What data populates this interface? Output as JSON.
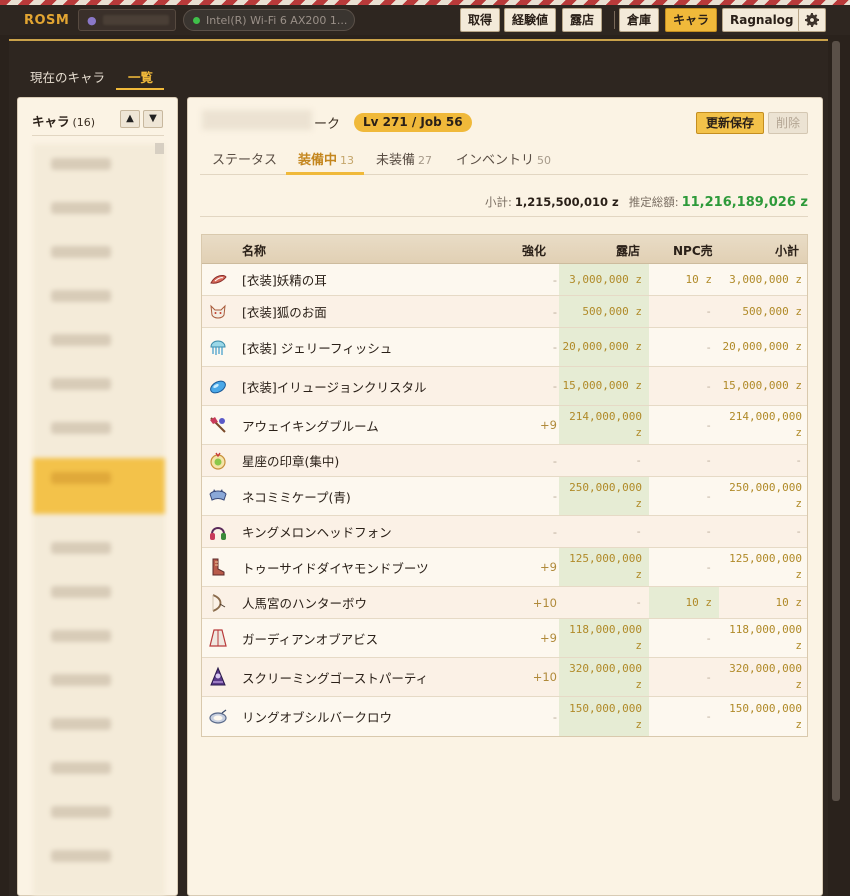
{
  "topbar": {
    "logo": "ROSM",
    "network": "Intel(R) Wi-Fi 6 AX200 1...",
    "buttons": [
      "取得",
      "経験値",
      "露店",
      "倉庫",
      "キャラ",
      "Ragnalog"
    ],
    "active_button": "キャラ"
  },
  "main_tabs": [
    "現在のキャラ",
    "一覧"
  ],
  "sidebar": {
    "title": "キャラ",
    "count": "(16)",
    "up": "▲",
    "down": "▼"
  },
  "character": {
    "name_suffix": "ーク",
    "level": "Lv 271 / Job 56",
    "save_label": "更新保存",
    "delete_label": "削除"
  },
  "tabs": [
    {
      "label": "ステータス",
      "count": ""
    },
    {
      "label": "装備中",
      "count": "13"
    },
    {
      "label": "未装備",
      "count": "27"
    },
    {
      "label": "インベントリ",
      "count": "50"
    }
  ],
  "summary": {
    "subtotal_label": "小計:",
    "subtotal_value": "1,215,500,010 z",
    "total_label": "推定総額:",
    "total_value": "11,216,189,026 z"
  },
  "table": {
    "headers": {
      "name": "名称",
      "refine": "強化",
      "shop": "露店",
      "npc": "NPC売",
      "sum": "小計"
    },
    "rows": [
      {
        "icon": "elf-ear-icon",
        "name": "[衣装]妖精の耳",
        "refine": "-",
        "shop": "3,000,000 z",
        "npc": "10 z",
        "sum": "3,000,000 z",
        "hl": "shop"
      },
      {
        "icon": "fox-mask-icon",
        "name": "[衣装]狐のお面",
        "refine": "-",
        "shop": "500,000 z",
        "npc": "-",
        "sum": "500,000 z",
        "hl": "shop"
      },
      {
        "icon": "jellyfish-icon",
        "name": "[衣装] ジェリーフィッシュ",
        "refine": "-",
        "shop": "20,000,000 z",
        "npc": "-",
        "sum": "20,000,000 z",
        "hl": "shop"
      },
      {
        "icon": "crystal-icon",
        "name": "[衣装]イリュージョンクリスタル",
        "refine": "-",
        "shop": "15,000,000 z",
        "npc": "-",
        "sum": "15,000,000 z",
        "hl": "shop"
      },
      {
        "icon": "broom-icon",
        "name": "アウェイキングブルーム",
        "refine": "+9",
        "shop": "214,000,000 z",
        "npc": "-",
        "sum": "214,000,000 z",
        "hl": "shop"
      },
      {
        "icon": "seal-icon",
        "name": "星座の印章(集中)",
        "refine": "-",
        "shop": "-",
        "npc": "-",
        "sum": "-",
        "hl": ""
      },
      {
        "icon": "cape-icon",
        "name": "ネコミミケープ(青)",
        "refine": "-",
        "shop": "250,000,000 z",
        "npc": "-",
        "sum": "250,000,000 z",
        "hl": "shop"
      },
      {
        "icon": "headphone-icon",
        "name": "キングメロンヘッドフォン",
        "refine": "-",
        "shop": "-",
        "npc": "-",
        "sum": "-",
        "hl": ""
      },
      {
        "icon": "boots-icon",
        "name": "トゥーサイドダイヤモンドブーツ",
        "refine": "+9",
        "shop": "125,000,000 z",
        "npc": "-",
        "sum": "125,000,000 z",
        "hl": "shop"
      },
      {
        "icon": "bow-icon",
        "name": "人馬宮のハンターボウ",
        "refine": "+10",
        "shop": "-",
        "npc": "10 z",
        "sum": "10 z",
        "hl": "npc"
      },
      {
        "icon": "robe-icon",
        "name": "ガーディアンオブアビス",
        "refine": "+9",
        "shop": "118,000,000 z",
        "npc": "-",
        "sum": "118,000,000 z",
        "hl": "shop"
      },
      {
        "icon": "ghost-party-icon",
        "name": "スクリーミングゴーストパーティ",
        "refine": "+10",
        "shop": "320,000,000 z",
        "npc": "-",
        "sum": "320,000,000 z",
        "hl": "shop"
      },
      {
        "icon": "ring-icon",
        "name": "リングオブシルバークロウ",
        "refine": "-",
        "shop": "150,000,000 z",
        "npc": "-",
        "sum": "150,000,000 z",
        "hl": "shop"
      }
    ]
  }
}
